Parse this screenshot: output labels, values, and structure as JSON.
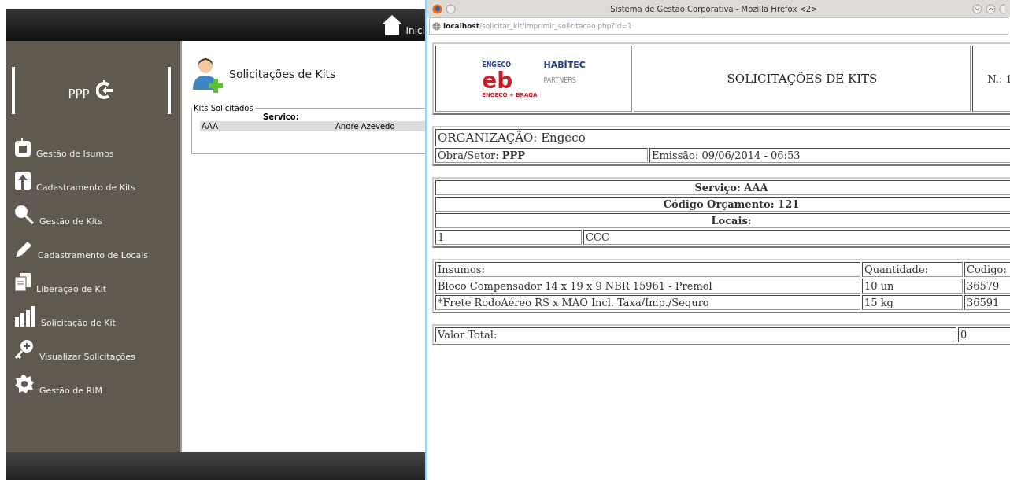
{
  "app": {
    "header": {
      "home_label": "Inici"
    },
    "sidebar": {
      "title": "PPP",
      "items": [
        {
          "label": "Gestão de Isumos"
        },
        {
          "label": "Cadastramento de Kits"
        },
        {
          "label": "Gestão de Kits"
        },
        {
          "label": "Cadastramento de Locais"
        },
        {
          "label": "Liberação de Kit"
        },
        {
          "label": "Solicitação de Kit"
        },
        {
          "label": "Visualizar Solicitações"
        },
        {
          "label": "Gestão de RIM"
        }
      ]
    },
    "page": {
      "title": "Solicitações de Kits",
      "fieldset": {
        "legend": "Kits Solicitados",
        "column_header": "Servico:",
        "rows": [
          {
            "cells": [
              "AAA",
              "Andre Azevedo"
            ]
          }
        ]
      }
    }
  },
  "browser": {
    "title": "Sistema de Gestão Corporativa - Mozilla Firefox <2>",
    "url": {
      "host": "localhost",
      "path": "/solicitar_kit/imprimir_solicitacao.php?id=1"
    },
    "document": {
      "logos": [
        "ENGECO",
        "HABİTEC",
        "eb",
        "PARTNERS",
        "ENGECO + BRAGA"
      ],
      "heading": "SOLICITAÇÕES DE KITS",
      "number": "N.: 1",
      "organization": "ORGANIZAÇÃO: Engeco",
      "obra": "Obra/Setor: **PPP**",
      "emissao": "Emissão: 09/06/2014 - 06:53",
      "servico": "Serviço: AAA",
      "codigo": "Código Orçamento: 121",
      "locais": "Locais:",
      "local_rows": [
        [
          "1",
          "CCC"
        ]
      ],
      "items_columns": [
        "Insumos:",
        "Quantidade:",
        "Codigo:"
      ],
      "items_rows": [
        [
          "Bloco Compensador 14 x 19 x 9 NBR 15961 - Premol",
          "10 un",
          "36579"
        ],
        [
          "*Frete RodoAéreo RS x MAO Incl. Taxa/Imp./Seguro",
          "15 kg",
          "36591"
        ]
      ],
      "total_label": "Valor Total:",
      "total_value": "0"
    }
  }
}
